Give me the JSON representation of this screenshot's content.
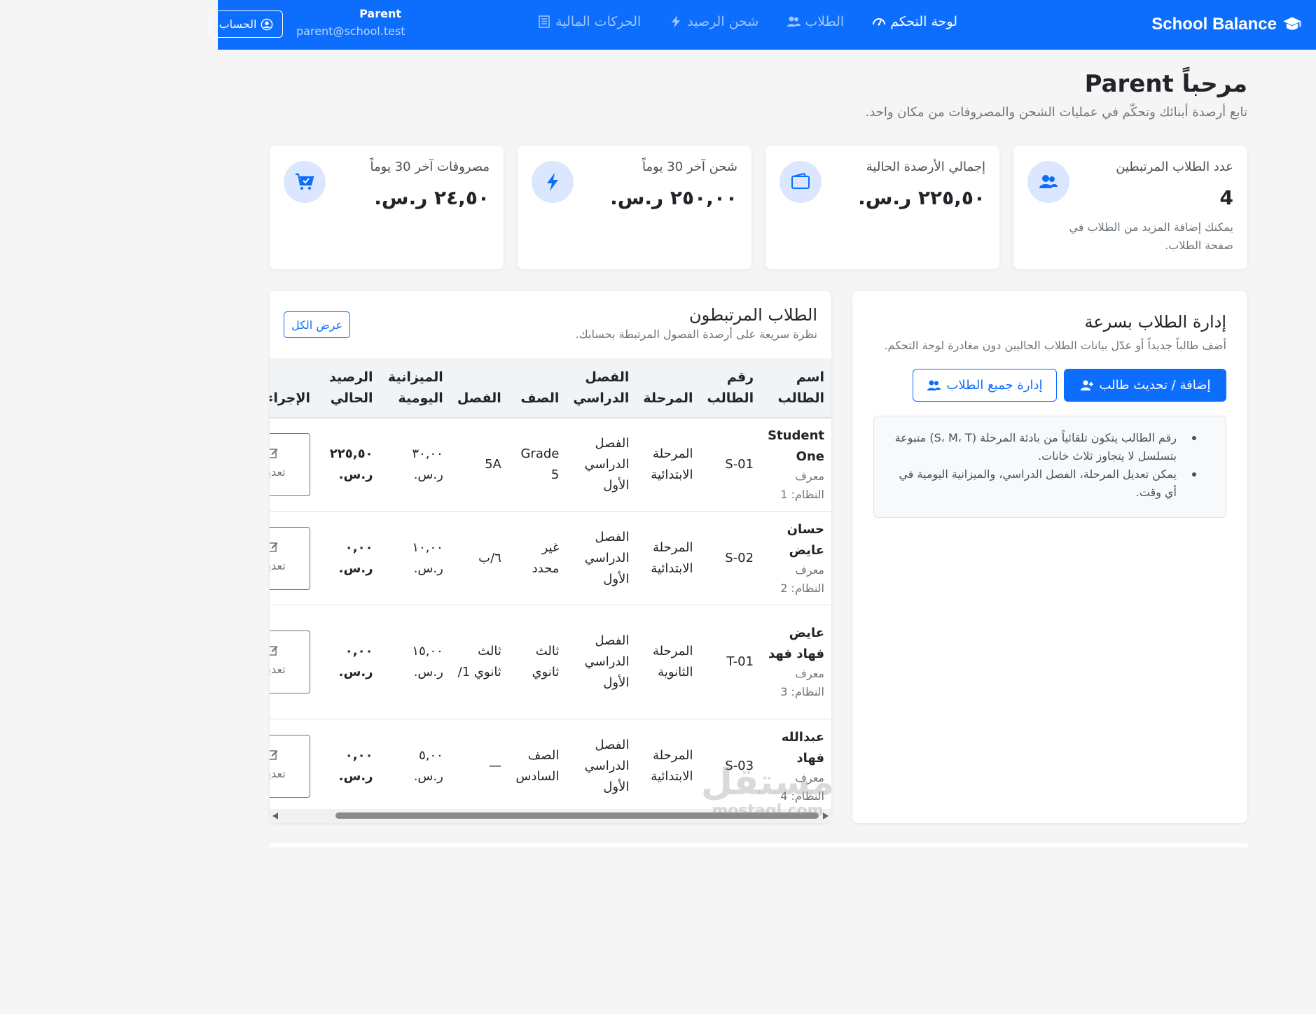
{
  "navbar": {
    "brand": "School Balance",
    "links": [
      {
        "label": "لوحة التحكم",
        "icon": "gauge-icon",
        "active": true
      },
      {
        "label": "الطلاب",
        "icon": "users-icon",
        "active": false
      },
      {
        "label": "شحن الرصيد",
        "icon": "bolt-icon",
        "active": false
      },
      {
        "label": "الحركات المالية",
        "icon": "receipt-icon",
        "active": false
      }
    ],
    "user_name": "Parent",
    "user_email": "parent@school.test",
    "account_label": "الحساب"
  },
  "header": {
    "title": "مرحباً Parent",
    "subtitle": "تابع أرصدة أبنائك وتحكّم في عمليات الشحن والمصروفات من مكان واحد."
  },
  "stats": [
    {
      "label": "عدد الطلاب المرتبطين",
      "value": "4",
      "note": "يمكنك إضافة المزيد من الطلاب في صفحة الطلاب.",
      "icon": "users-icon"
    },
    {
      "label": "إجمالي الأرصدة الحالية",
      "value": "٢٢٥,٥٠ ر.س.",
      "icon": "wallet-icon"
    },
    {
      "label": "شحن آخر 30 يوماً",
      "value": "٢٥٠,٠٠ ر.س.",
      "icon": "bolt-icon"
    },
    {
      "label": "مصروفات آخر 30 يوماً",
      "value": "٢٤,٥٠ ر.س.",
      "icon": "cart-icon"
    }
  ],
  "manage": {
    "title": "إدارة الطلاب بسرعة",
    "subtitle": "أضف طالباً جديداً أو عدّل بيانات الطلاب الحاليين دون مغادرة لوحة التحكم.",
    "add_button": "إضافة / تحديث طالب",
    "manage_button": "إدارة جميع الطلاب",
    "notes": [
      "رقم الطالب يتكون تلقائياً من بادئة المرحلة (S، M، T) متبوعة بتسلسل لا يتجاوز ثلاث خانات.",
      "يمكن تعديل المرحلة، الفصل الدراسي، والميزانية اليومية في أي وقت."
    ]
  },
  "students": {
    "title": "الطلاب المرتبطون",
    "subtitle": "نظرة سريعة على أرصدة الفصول المرتبطة بحسابك.",
    "view_all": "عرض الكل",
    "columns": [
      "اسم الطالب",
      "رقم الطالب",
      "المرحلة",
      "الفصل الدراسي",
      "الصف",
      "الفصل",
      "الميزانية اليومية",
      "الرصيد الحالي",
      "الإجراءات"
    ],
    "rows": [
      {
        "name": "Student One",
        "system_id": "معرف النظام: 1",
        "number": "S-01",
        "stage": "المرحلة الابتدائية",
        "term": "الفصل الدراسي الأول",
        "grade": "Grade 5",
        "class": "5A",
        "daily": "٣٠,٠٠ ر.س.",
        "balance": "٢٢٥,٥٠ ر.س.",
        "action": "تعديل"
      },
      {
        "name": "حسان عايض",
        "system_id": "معرف النظام: 2",
        "number": "S-02",
        "stage": "المرحلة الابتدائية",
        "term": "الفصل الدراسي الأول",
        "grade": "غير محدد",
        "class": "٦/ب",
        "daily": "١٠,٠٠ ر.س.",
        "balance": "٠,٠٠ ر.س.",
        "action": "تعديل"
      },
      {
        "name": "عايض فهاد فهد",
        "system_id": "معرف النظام: 3",
        "number": "T-01",
        "stage": "المرحلة الثانوية",
        "term": "الفصل الدراسي الأول",
        "grade": "ثالث ثانوي",
        "class": "ثالث ثانوي 1/",
        "daily": "١٥,٠٠ ر.س.",
        "balance": "٠,٠٠ ر.س.",
        "action": "تعديل"
      },
      {
        "name": "عبدالله فهاد",
        "system_id": "معرف النظام: 4",
        "number": "S-03",
        "stage": "المرحلة الابتدائية",
        "term": "الفصل الدراسي الأول",
        "grade": "الصف السادس",
        "class": "—",
        "daily": "٥,٠٠ ر.س.",
        "balance": "٠,٠٠ ر.س.",
        "action": "تعديل"
      }
    ]
  },
  "watermark": {
    "line1": "مستقل",
    "line2": "mostaql.com"
  },
  "colors": {
    "primary": "#0d6efd",
    "background": "#f5f5f5",
    "icon_bg": "#dbe7fe"
  }
}
